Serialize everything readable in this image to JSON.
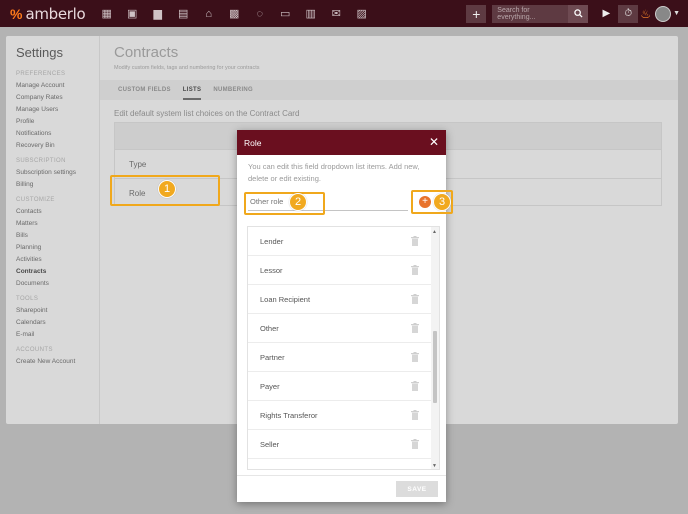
{
  "brand": {
    "name": "amberlo"
  },
  "topbar": {
    "nav_icons": [
      "dashboard-icon",
      "contacts-icon",
      "briefcase-icon",
      "document-icon",
      "bank-icon",
      "calendar-icon",
      "chat-icon",
      "folder-icon",
      "file-icon",
      "mail-icon",
      "image-icon"
    ],
    "search_placeholder": "Search for everything..."
  },
  "sidebar": {
    "title": "Settings",
    "sections": [
      {
        "label": "PREFERENCES",
        "items": [
          "Manage Account",
          "Company Rates",
          "Manage Users",
          "Profile",
          "Notifications",
          "Recovery Bin"
        ]
      },
      {
        "label": "SUBSCRIPTION",
        "items": [
          "Subscription settings",
          "Billing"
        ]
      },
      {
        "label": "CUSTOMIZE",
        "items": [
          "Contacts",
          "Matters",
          "Bills",
          "Planning",
          "Activities",
          "Contracts",
          "Documents"
        ]
      },
      {
        "label": "TOOLS",
        "items": [
          "Sharepoint",
          "Calendars",
          "E-mail"
        ]
      },
      {
        "label": "ACCOUNTS",
        "items": [
          "Create New Account"
        ]
      }
    ],
    "active_item": "Contracts"
  },
  "main": {
    "title": "Contracts",
    "subtitle": "Modify custom fields, tags and numbering for your contracts",
    "tabs": [
      "CUSTOM FIELDS",
      "LISTS",
      "NUMBERING"
    ],
    "active_tab": "LISTS",
    "description": "Edit default system list choices on the Contract Card",
    "rows": [
      "Type",
      "Role"
    ]
  },
  "modal": {
    "title": "Role",
    "close_glyph": "✕",
    "help_text": "You can edit this field dropdown list items. Add new, delete or edit existing.",
    "input_placeholder": "Other role",
    "items": [
      "Lender",
      "Lessor",
      "Loan Recipient",
      "Other",
      "Partner",
      "Payer",
      "Rights Transferor",
      "Seller"
    ],
    "save_label": "SAVE"
  },
  "callouts": [
    "1",
    "2",
    "3"
  ],
  "colors": {
    "topbar": "#3b0f19",
    "modal_header": "#6a0f1f",
    "accent": "#f1a91f",
    "add_icon": "#e8732c"
  }
}
